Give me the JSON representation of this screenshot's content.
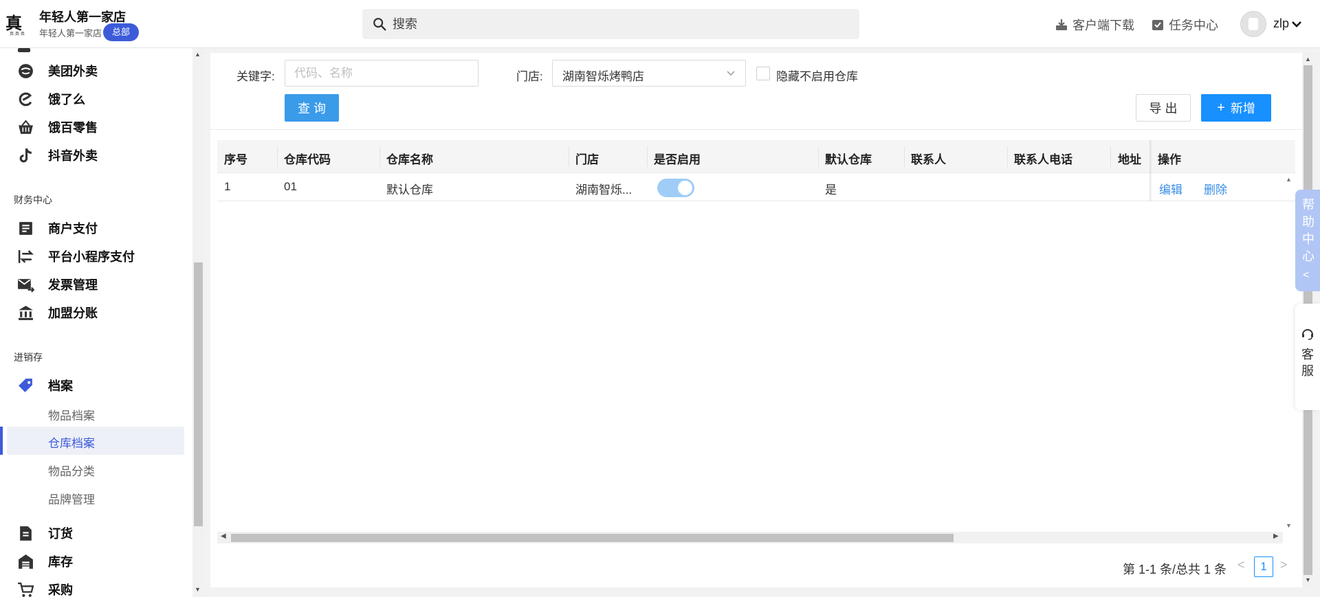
{
  "header": {
    "logo_glyph": "真",
    "logo_small": "真·真·真",
    "store_name": "年轻人第一家店",
    "store_sub": "年轻人第一家店",
    "hq_badge": "总部",
    "search_placeholder": "搜索",
    "download_label": "客户端下载",
    "task_center_label": "任务中心",
    "username": "zlp"
  },
  "sidebar": {
    "top_items": [
      {
        "label": "美团外卖",
        "icon": "meituan-icon"
      },
      {
        "label": "饿了么",
        "icon": "eleme-icon"
      },
      {
        "label": "饿百零售",
        "icon": "basket-icon"
      },
      {
        "label": "抖音外卖",
        "icon": "tiktok-icon"
      }
    ],
    "finance_section": "财务中心",
    "finance_items": [
      {
        "label": "商户支付",
        "icon": "document-icon"
      },
      {
        "label": "平台小程序支付",
        "icon": "transfer-icon"
      },
      {
        "label": "发票管理",
        "icon": "invoice-mail-icon"
      },
      {
        "label": "加盟分账",
        "icon": "bank-icon"
      }
    ],
    "inventory_section": "进销存",
    "archive_label": "档案",
    "archive_sub": [
      {
        "label": "物品档案",
        "active": false
      },
      {
        "label": "仓库档案",
        "active": true
      },
      {
        "label": "物品分类",
        "active": false
      },
      {
        "label": "品牌管理",
        "active": false
      }
    ],
    "bottom_items": [
      {
        "label": "订货",
        "icon": "order-doc-icon"
      },
      {
        "label": "库存",
        "icon": "warehouse-icon"
      },
      {
        "label": "采购",
        "icon": "cart-icon"
      }
    ]
  },
  "filters": {
    "keyword_label": "关键字:",
    "keyword_placeholder": "代码、名称",
    "keyword_value": "",
    "store_label": "门店:",
    "store_value": "湖南智烁烤鸭店",
    "hide_disabled_label": "隐藏不启用仓库",
    "hide_disabled_checked": false,
    "query_button": "查 询",
    "export_button": "导 出",
    "add_button": "新增",
    "add_icon": "+"
  },
  "table": {
    "columns": [
      "序号",
      "仓库代码",
      "仓库名称",
      "门店",
      "是否启用",
      "默认仓库",
      "联系人",
      "联系人电话",
      "地址",
      "操作"
    ],
    "rows": [
      {
        "index": "1",
        "code": "01",
        "name": "默认仓库",
        "store": "湖南智烁...",
        "enabled": true,
        "is_default": "是",
        "contact": "",
        "phone": "",
        "address": "",
        "edit": "编辑",
        "delete": "删除"
      }
    ]
  },
  "pagination": {
    "info": "第 1-1 条/总共 1 条",
    "current_page": "1",
    "prev": "<",
    "next": ">"
  },
  "float": {
    "help_text": "帮助中心",
    "help_chevron": "<",
    "service_text": "客服"
  },
  "colors": {
    "brand": "#3d5bd9",
    "primary": "#1890ff",
    "query": "#3a9be9",
    "toggle_on": "#9fcdf7",
    "help_tab": "#b1c6f5"
  }
}
